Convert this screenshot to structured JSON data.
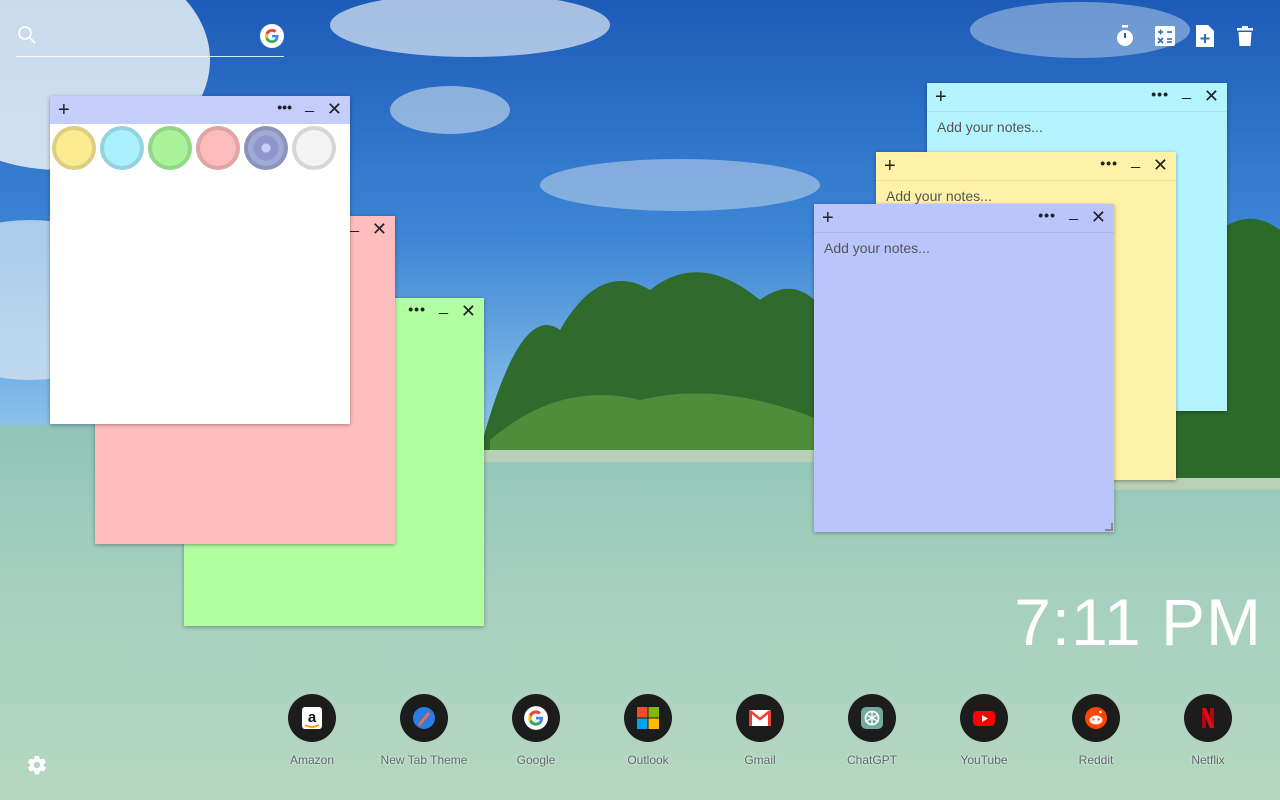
{
  "search": {
    "placeholder": ""
  },
  "toolbar": {
    "items": [
      {
        "icon": "stopwatch-icon"
      },
      {
        "icon": "calculator-icon"
      },
      {
        "icon": "add-note-icon"
      },
      {
        "icon": "trash-icon"
      }
    ]
  },
  "notes": {
    "placeholder": "Add your notes...",
    "colors": {
      "white": "#ffffff",
      "pink": "#ffbebe",
      "green": "#b2ffa1",
      "cyan": "#b4f4ff",
      "yellow": "#fff2a8",
      "periwinkle": "#bac6fb",
      "periwinkle_header": "#c5cdfa"
    }
  },
  "palette": {
    "swatches": [
      {
        "name": "yellow",
        "color": "#fdeb92"
      },
      {
        "name": "cyan",
        "color": "#aaf0fd"
      },
      {
        "name": "green",
        "color": "#a9f39a"
      },
      {
        "name": "pink",
        "color": "#fdbcbc"
      },
      {
        "name": "periwinkle",
        "color": "#8f98cd"
      },
      {
        "name": "white",
        "color": "#f4f4f4"
      }
    ]
  },
  "clock": {
    "time": "7:11 PM"
  },
  "dock": {
    "apps": [
      {
        "label": "Amazon",
        "icon": "amazon-icon"
      },
      {
        "label": "New Tab Theme",
        "icon": "new-tab-theme-icon"
      },
      {
        "label": "Google",
        "icon": "google-icon"
      },
      {
        "label": "Outlook",
        "icon": "outlook-icon"
      },
      {
        "label": "Gmail",
        "icon": "gmail-icon"
      },
      {
        "label": "ChatGPT",
        "icon": "chatgpt-icon"
      },
      {
        "label": "YouTube",
        "icon": "youtube-icon"
      },
      {
        "label": "Reddit",
        "icon": "reddit-icon"
      },
      {
        "label": "Netflix",
        "icon": "netflix-icon"
      }
    ]
  }
}
